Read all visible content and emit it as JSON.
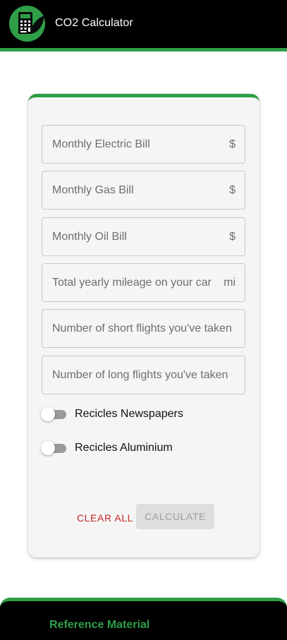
{
  "app": {
    "title": "CO2 Calculator",
    "logo_icon": "calculator-leaf-icon",
    "accent_color": "#2e9e47"
  },
  "form": {
    "fields": [
      {
        "placeholder": "Monthly Electric Bill",
        "suffix": "$"
      },
      {
        "placeholder": "Monthly Gas Bill",
        "suffix": "$"
      },
      {
        "placeholder": "Monthly Oil Bill",
        "suffix": "$"
      },
      {
        "placeholder": "Total yearly mileage on your car",
        "suffix": "mi"
      },
      {
        "placeholder": "Number of short flights you've taken",
        "suffix": ""
      },
      {
        "placeholder": "Number of long flights you've taken",
        "suffix": ""
      }
    ],
    "toggles": [
      {
        "label": "Recicles Newspapers",
        "checked": false
      },
      {
        "label": "Recicles Aluminium",
        "checked": false
      }
    ],
    "clear_label": "CLEAR ALL",
    "calculate_label": "CALCULATE",
    "calculate_disabled": true
  },
  "reference": {
    "title": "Reference Material"
  }
}
